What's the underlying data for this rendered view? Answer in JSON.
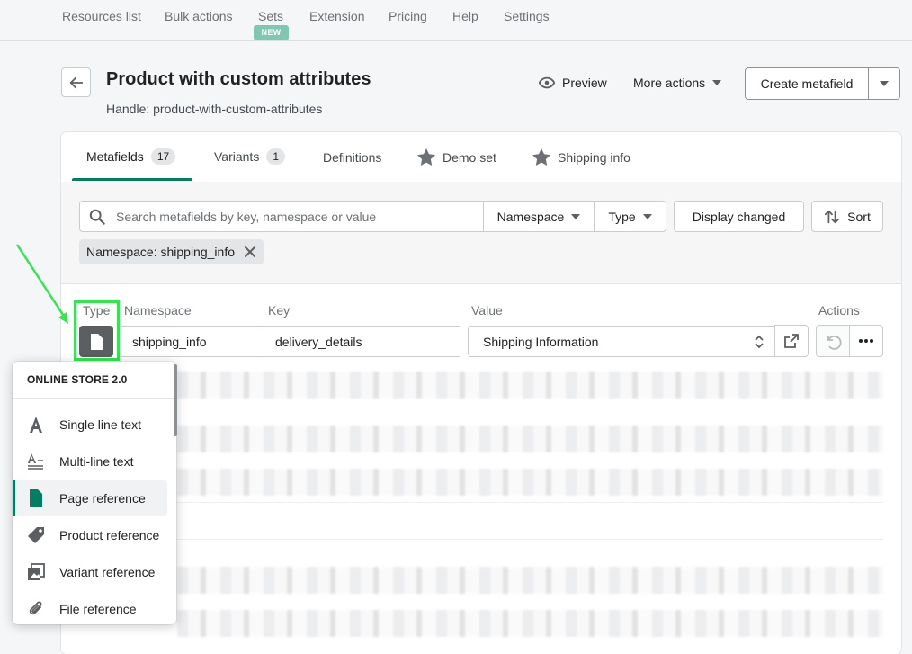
{
  "nav": {
    "items": [
      "Resources list",
      "Bulk actions",
      "Sets",
      "Extension",
      "Pricing",
      "Help",
      "Settings"
    ],
    "new_badge": "NEW"
  },
  "header": {
    "title": "Product with custom attributes",
    "handle": "Handle: product-with-custom-attributes",
    "preview": "Preview",
    "more_actions": "More actions",
    "create": "Create metafield"
  },
  "tabs": [
    {
      "label": "Metafields",
      "count": "17"
    },
    {
      "label": "Variants",
      "count": "1"
    },
    {
      "label": "Definitions"
    },
    {
      "label": "Demo set"
    },
    {
      "label": "Shipping info"
    }
  ],
  "filters": {
    "search_placeholder": "Search metafields by key, namespace or value",
    "namespace": "Namespace",
    "type": "Type",
    "display_changed": "Display changed",
    "sort": "Sort",
    "chip": "Namespace: shipping_info"
  },
  "table": {
    "columns": [
      "Type",
      "Namespace",
      "Key",
      "Value",
      "Actions"
    ],
    "row": {
      "namespace": "shipping_info",
      "key": "delivery_details",
      "value": "Shipping Information"
    }
  },
  "popup": {
    "header": "ONLINE STORE 2.0",
    "items": [
      "Single line text",
      "Multi-line text",
      "Page reference",
      "Product reference",
      "Variant reference",
      "File reference"
    ],
    "selected_index": 2
  },
  "colors": {
    "accent": "#008060",
    "highlight": "#2ee84c"
  }
}
